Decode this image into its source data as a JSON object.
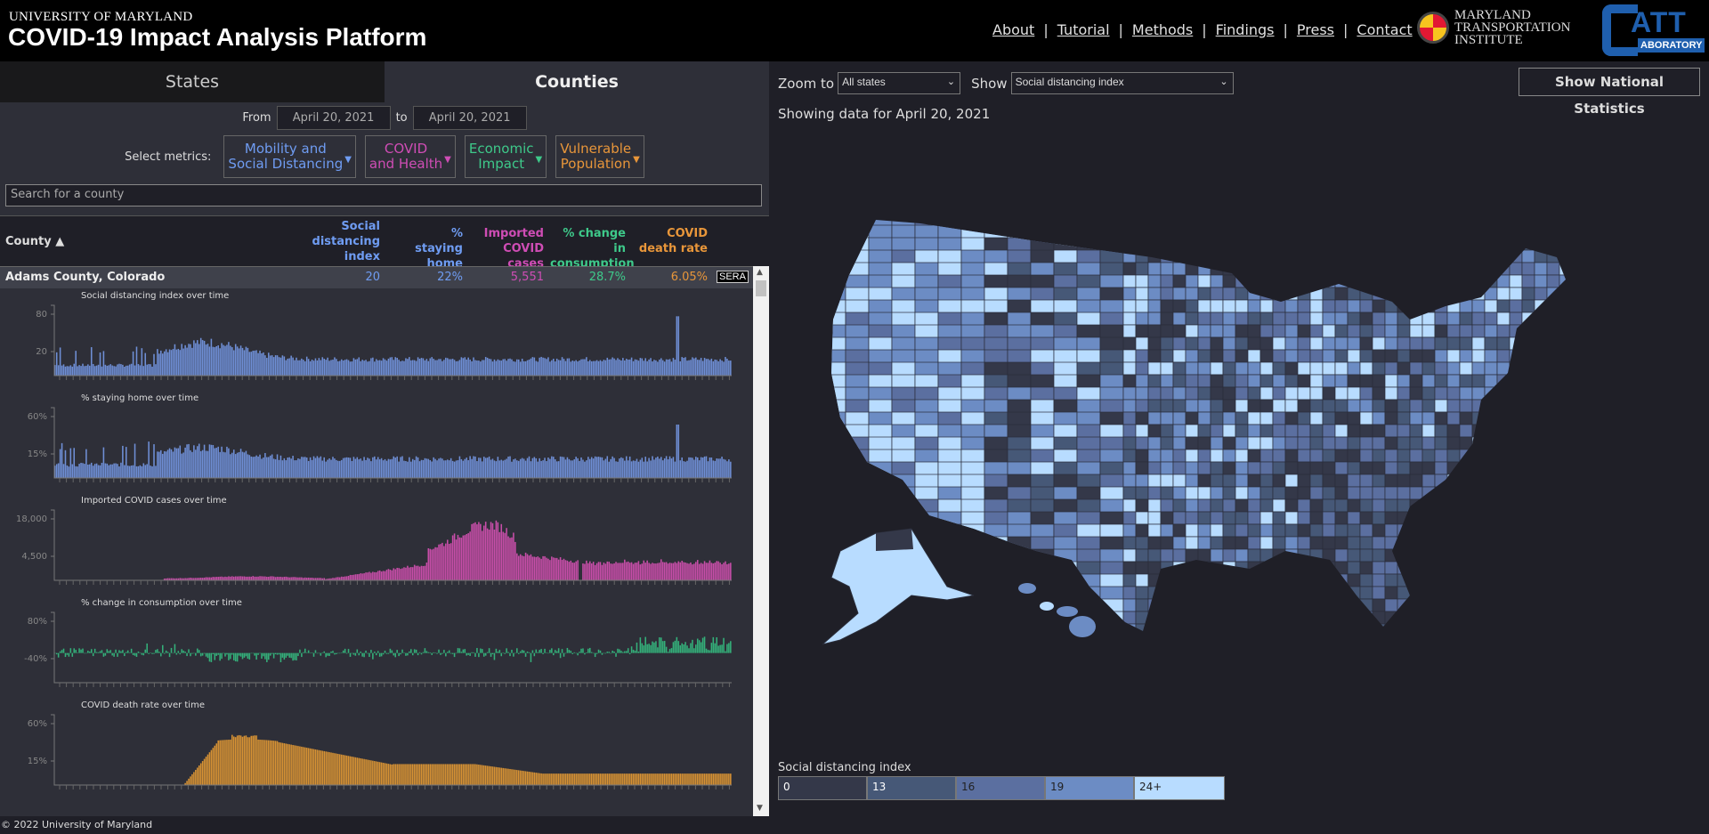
{
  "header": {
    "university": "UNIVERSITY OF MARYLAND",
    "title": "COVID-19 Impact Analysis Platform",
    "nav": [
      "About",
      "Tutorial",
      "Methods",
      "Findings",
      "Press",
      "Contact"
    ],
    "mti_lines": [
      "MARYLAND",
      "TRANSPORTATION",
      "INSTITUTE"
    ],
    "catt_logo": {
      "big": "ATT",
      "small": "ABORATORY"
    }
  },
  "tabs": {
    "states": "States",
    "counties": "Counties",
    "active": "Counties"
  },
  "date_range": {
    "from_label": "From",
    "from": "April 20, 2021",
    "to_label": "to",
    "to": "April 20, 2021"
  },
  "metrics": {
    "label": "Select metrics:",
    "groups": [
      {
        "line1": "Mobility and",
        "line2": "Social Distancing",
        "color": "#6f9cf2"
      },
      {
        "line1": "COVID",
        "line2": "and Health",
        "color": "#cf4db5"
      },
      {
        "line1": "Economic",
        "line2": "Impact",
        "color": "#3ec98a"
      },
      {
        "line1": "Vulnerable",
        "line2": "Population",
        "color": "#e8963a"
      }
    ]
  },
  "search": {
    "placeholder": "Search for a county"
  },
  "table": {
    "columns": [
      {
        "label": "County ▲",
        "color": "#dddddd"
      },
      {
        "label": "Social distancing index",
        "color": "#6f9cf2"
      },
      {
        "label": "% staying home",
        "color": "#6f9cf2"
      },
      {
        "label": "Imported COVID cases",
        "color": "#cf4db5"
      },
      {
        "label": "% change in consumption",
        "color": "#3ec98a"
      },
      {
        "label": "COVID death rate",
        "color": "#e8963a"
      }
    ],
    "rows": [
      {
        "county": "Adams County, Colorado",
        "sdi": "20",
        "home": "22%",
        "imported": "5,551",
        "consumption": "28.7%",
        "death": "6.05%",
        "badge": "SERA"
      }
    ]
  },
  "chart_data": [
    {
      "type": "bar",
      "title": "Social distancing index over time",
      "yticks": [
        "80",
        "20"
      ],
      "ylim": [
        0,
        90
      ],
      "color": "#6f8fd6",
      "shape": {
        "n": 390,
        "base": 14,
        "peak_at": 0.22,
        "peak": 45,
        "tail": 22,
        "spikes": [
          [
            0.92,
            80
          ]
        ]
      }
    },
    {
      "type": "bar",
      "title": "% staying home over time",
      "yticks": [
        "60%",
        "15%"
      ],
      "ylim": [
        0,
        70
      ],
      "color": "#6f8fd6",
      "shape": {
        "n": 390,
        "base": 14,
        "peak_at": 0.22,
        "peak": 32,
        "tail": 20,
        "spikes": [
          [
            0.92,
            56
          ]
        ]
      }
    },
    {
      "type": "bar",
      "title": "Imported COVID cases over time",
      "yticks": [
        "18,000",
        "4,500"
      ],
      "ylim": [
        0,
        20000
      ],
      "color": "#c84ea9",
      "shape": {
        "n": 390,
        "kind": "imported"
      }
    },
    {
      "type": "bar",
      "title": "% change in consumption over time",
      "yticks": [
        "80%",
        "-40%"
      ],
      "ylim": [
        -80,
        100
      ],
      "color": "#34b07a",
      "shape": {
        "n": 390,
        "kind": "consumption"
      }
    },
    {
      "type": "bar",
      "title": "COVID death rate over time",
      "yticks": [
        "60%",
        "15%"
      ],
      "ylim": [
        0,
        70
      ],
      "color": "#d89334",
      "shape": {
        "n": 390,
        "kind": "death"
      }
    }
  ],
  "map": {
    "zoom_label": "Zoom to",
    "zoom_value": "All states",
    "show_label": "Show",
    "show_value": "Social distancing index",
    "showing": "Showing data for April 20, 2021",
    "national_button": "Show National Statistics",
    "legend": {
      "title": "Social distancing index",
      "bins": [
        {
          "label": "0",
          "color": "#343849",
          "text": "#ffffff"
        },
        {
          "label": "13",
          "color": "#465877",
          "text": "#ffffff"
        },
        {
          "label": "16",
          "color": "#5b6fa0",
          "text": "#222222"
        },
        {
          "label": "19",
          "color": "#6c8cc4",
          "text": "#222222"
        },
        {
          "label": "24+",
          "color": "#b8dcff",
          "text": "#222222"
        }
      ]
    }
  },
  "footer": "© 2022 University of Maryland"
}
